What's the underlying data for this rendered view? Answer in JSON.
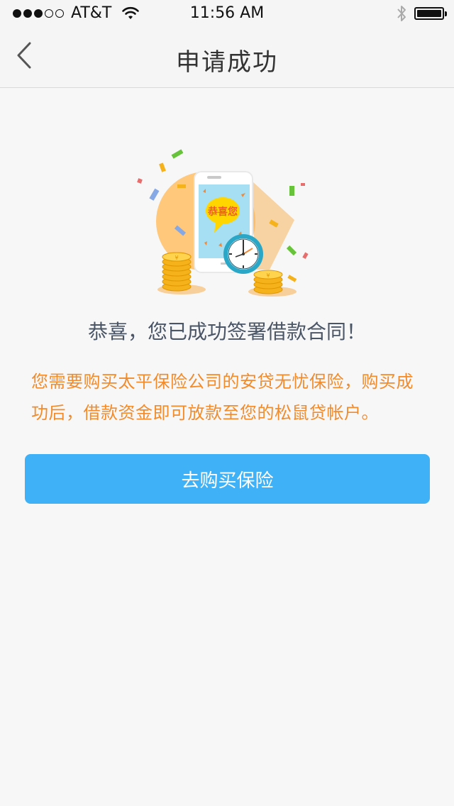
{
  "status_bar": {
    "carrier": "AT&T",
    "time": "11:56 AM",
    "signal_bars_filled": 3,
    "signal_bars_total": 5,
    "battery_level": 1.0,
    "icons": [
      "wifi-icon",
      "bluetooth-icon",
      "battery-icon"
    ]
  },
  "nav": {
    "title": "申请成功",
    "back_icon": "chevron-left-icon"
  },
  "illustration": {
    "badge_text": "恭喜您",
    "icons": [
      "phone-illustration",
      "clock-icon",
      "coin-stack-icon",
      "confetti"
    ]
  },
  "main": {
    "success_message": "恭喜，您已成功签署借款合同！",
    "insurance_notice": "您需要购买太平保险公司的安贷无忧保险，购买成功后，借款资金即可放款至您的松鼠贷帐户。",
    "buy_button_label": "去购买保险"
  },
  "colors": {
    "accent": "#3fb1f6",
    "notice": "#f28b2b",
    "message": "#4a5566",
    "background": "#f7f7f7"
  }
}
